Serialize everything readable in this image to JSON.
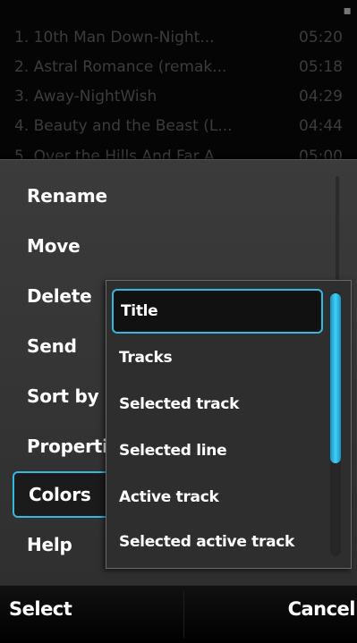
{
  "playlist": {
    "tracks": [
      {
        "title": "1. 10th Man Down-Night...",
        "duration": "05:20"
      },
      {
        "title": "2. Astral Romance (remak...",
        "duration": "05:18"
      },
      {
        "title": "3. Away-NightWish",
        "duration": "04:29"
      },
      {
        "title": "4. Beauty and the Beast (L...",
        "duration": "04:44"
      },
      {
        "title": "5. Over the Hills And Far A...",
        "duration": "05:00"
      }
    ]
  },
  "options_menu": {
    "items": [
      {
        "label": "Rename"
      },
      {
        "label": "Move"
      },
      {
        "label": "Delete"
      },
      {
        "label": "Send"
      },
      {
        "label": "Sort by"
      },
      {
        "label": "Properties"
      },
      {
        "label": "Colors",
        "highlighted": true
      },
      {
        "label": "Help"
      }
    ]
  },
  "colors_submenu": {
    "items": [
      {
        "label": "Title",
        "highlighted": true
      },
      {
        "label": "Tracks"
      },
      {
        "label": "Selected track"
      },
      {
        "label": "Selected line"
      },
      {
        "label": "Active track"
      },
      {
        "label": "Selected active track"
      }
    ],
    "accent_color": "#35b8e0"
  },
  "softkeys": {
    "left_label": "Select",
    "right_label": "Cancel"
  }
}
